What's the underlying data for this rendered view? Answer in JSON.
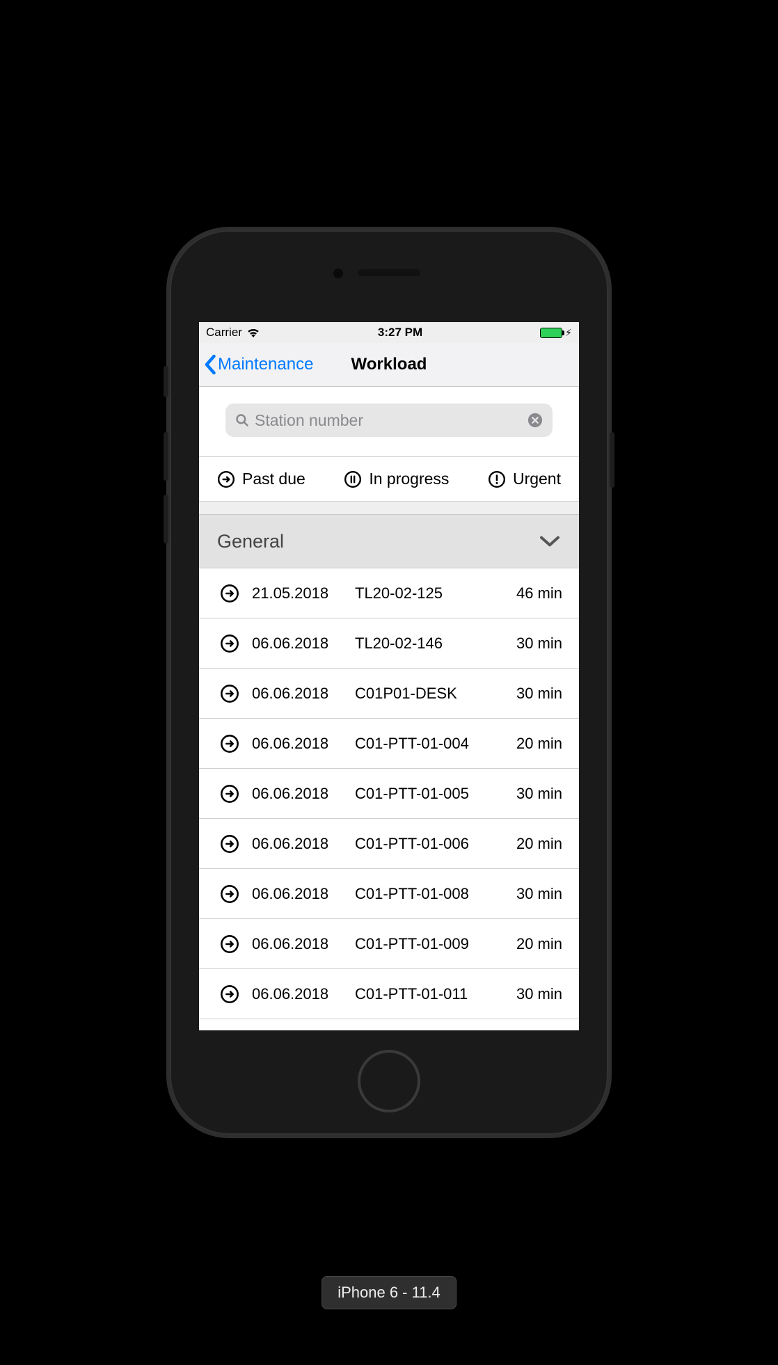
{
  "statusbar": {
    "carrier": "Carrier",
    "time": "3:27 PM"
  },
  "nav": {
    "back_label": "Maintenance",
    "title": "Workload"
  },
  "search": {
    "placeholder": "Station number"
  },
  "filters": {
    "past_due": "Past due",
    "in_progress": "In progress",
    "urgent": "Urgent"
  },
  "section": {
    "title": "General"
  },
  "rows": [
    {
      "date": "21.05.2018",
      "code": "TL20-02-125",
      "duration": "46 min"
    },
    {
      "date": "06.06.2018",
      "code": "TL20-02-146",
      "duration": "30 min"
    },
    {
      "date": "06.06.2018",
      "code": "C01P01-DESK",
      "duration": "30 min"
    },
    {
      "date": "06.06.2018",
      "code": "C01-PTT-01-004",
      "duration": "20 min"
    },
    {
      "date": "06.06.2018",
      "code": "C01-PTT-01-005",
      "duration": "30 min"
    },
    {
      "date": "06.06.2018",
      "code": "C01-PTT-01-006",
      "duration": "20 min"
    },
    {
      "date": "06.06.2018",
      "code": "C01-PTT-01-008",
      "duration": "30 min"
    },
    {
      "date": "06.06.2018",
      "code": "C01-PTT-01-009",
      "duration": "20 min"
    },
    {
      "date": "06.06.2018",
      "code": "C01-PTT-01-011",
      "duration": "30 min"
    }
  ],
  "caption": "iPhone 6 - 11.4"
}
